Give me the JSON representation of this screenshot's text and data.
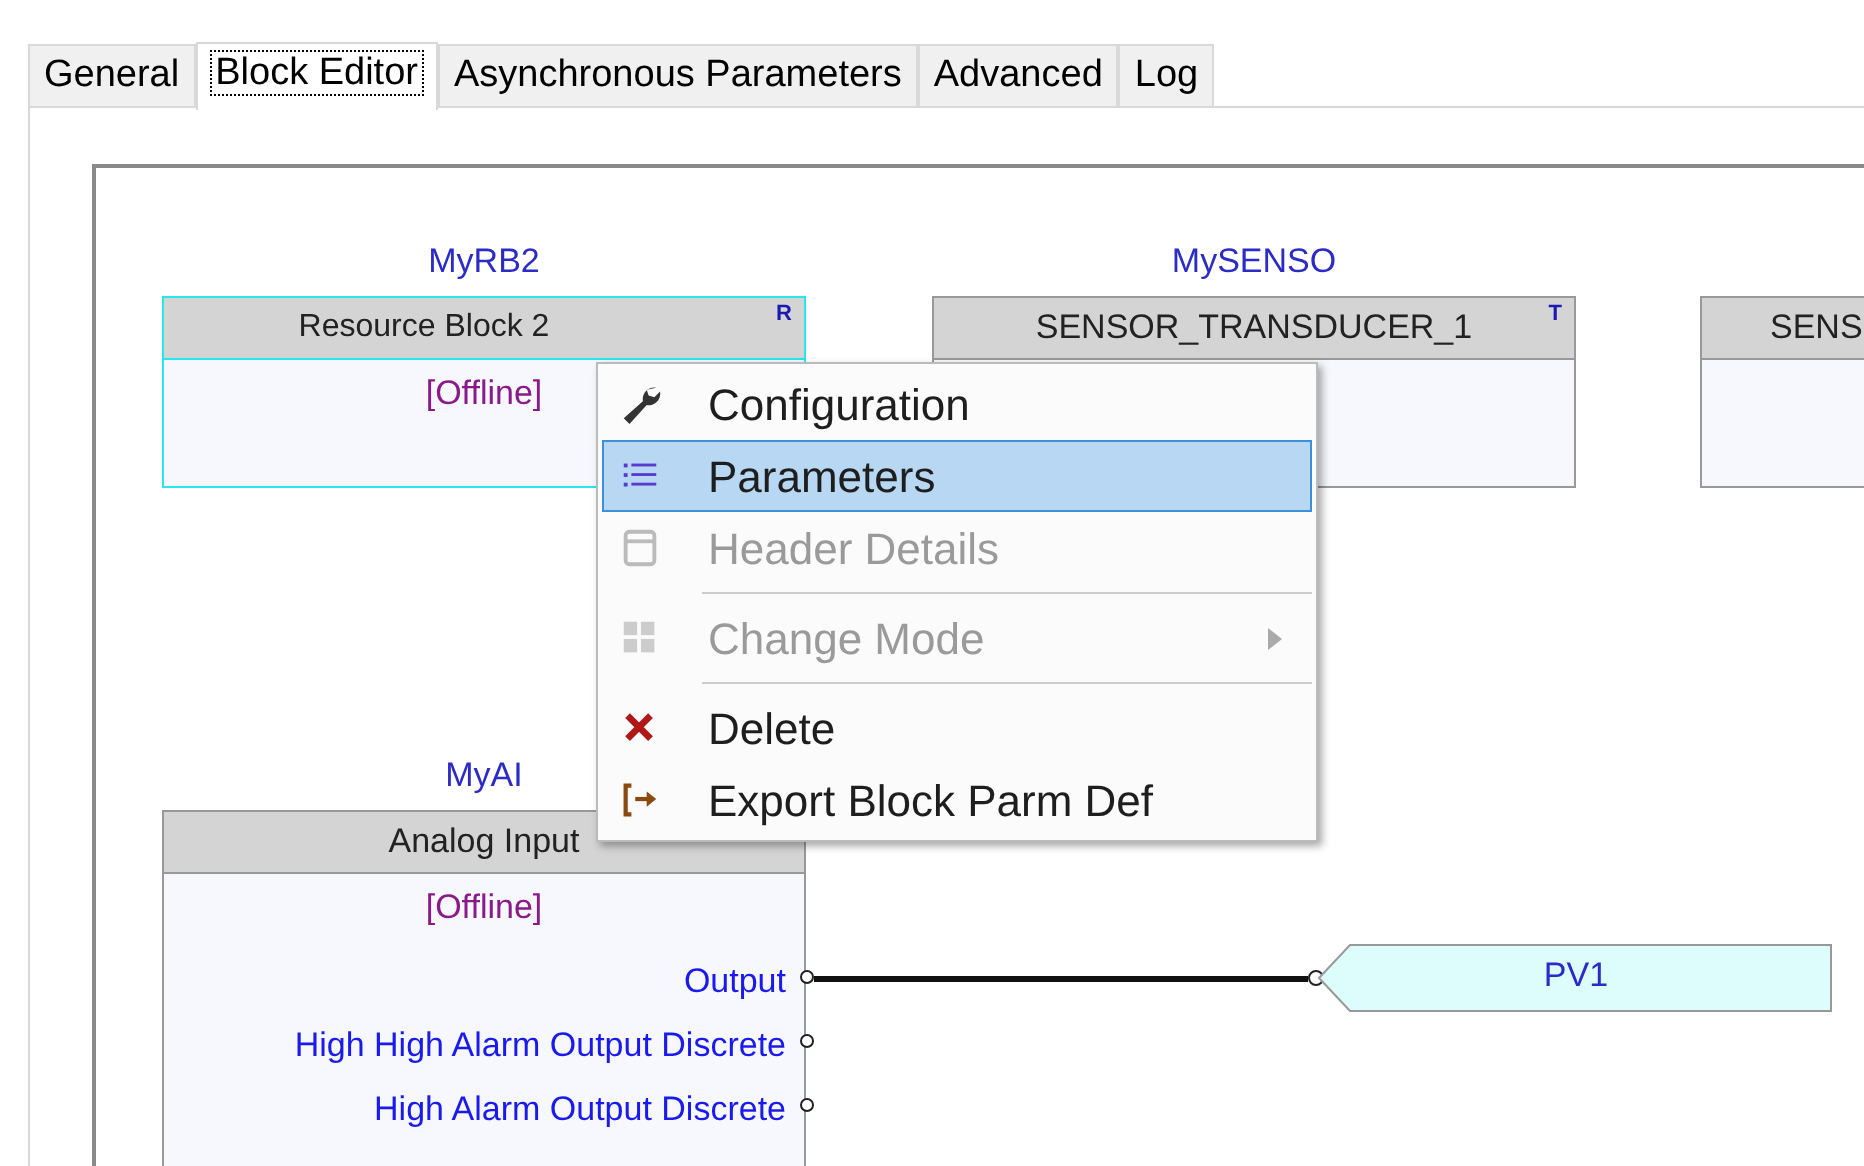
{
  "tabs": [
    {
      "label": "General",
      "selected": false
    },
    {
      "label": "Block Editor",
      "selected": true
    },
    {
      "label": "Asynchronous Parameters",
      "selected": false
    },
    {
      "label": "Advanced",
      "selected": false
    },
    {
      "label": "Log",
      "selected": false
    }
  ],
  "blocks": [
    {
      "tag": "MyRB2",
      "title": "Resource Block 2",
      "badge": "R",
      "status": "[Offline]",
      "selected": true
    },
    {
      "tag": "MySENSO",
      "title": "SENSOR_TRANSDUCER_1",
      "badge": "T",
      "selected": false
    },
    {
      "title": "SENS",
      "selected": false
    },
    {
      "tag": "MyAI",
      "title": "Analog Input",
      "status": "[Offline]",
      "selected": false,
      "ports": [
        {
          "label": "Output"
        },
        {
          "label": "High High Alarm Output Discrete"
        },
        {
          "label": "High Alarm Output Discrete"
        }
      ]
    }
  ],
  "output_tags": [
    {
      "label": "PV1"
    }
  ],
  "context_menu": [
    {
      "kind": "item",
      "label": "Configuration",
      "disabled": false,
      "selected": false,
      "submenu": false
    },
    {
      "kind": "item",
      "label": "Parameters",
      "disabled": false,
      "selected": true,
      "submenu": false
    },
    {
      "kind": "item",
      "label": "Header Details",
      "disabled": true,
      "selected": false,
      "submenu": false
    },
    {
      "kind": "separator"
    },
    {
      "kind": "item",
      "label": "Change Mode",
      "disabled": true,
      "selected": false,
      "submenu": true
    },
    {
      "kind": "separator"
    },
    {
      "kind": "item",
      "label": "Delete",
      "disabled": false,
      "selected": false,
      "submenu": false
    },
    {
      "kind": "item",
      "label": "Export Block Parm Def",
      "disabled": false,
      "selected": false,
      "submenu": false
    }
  ]
}
